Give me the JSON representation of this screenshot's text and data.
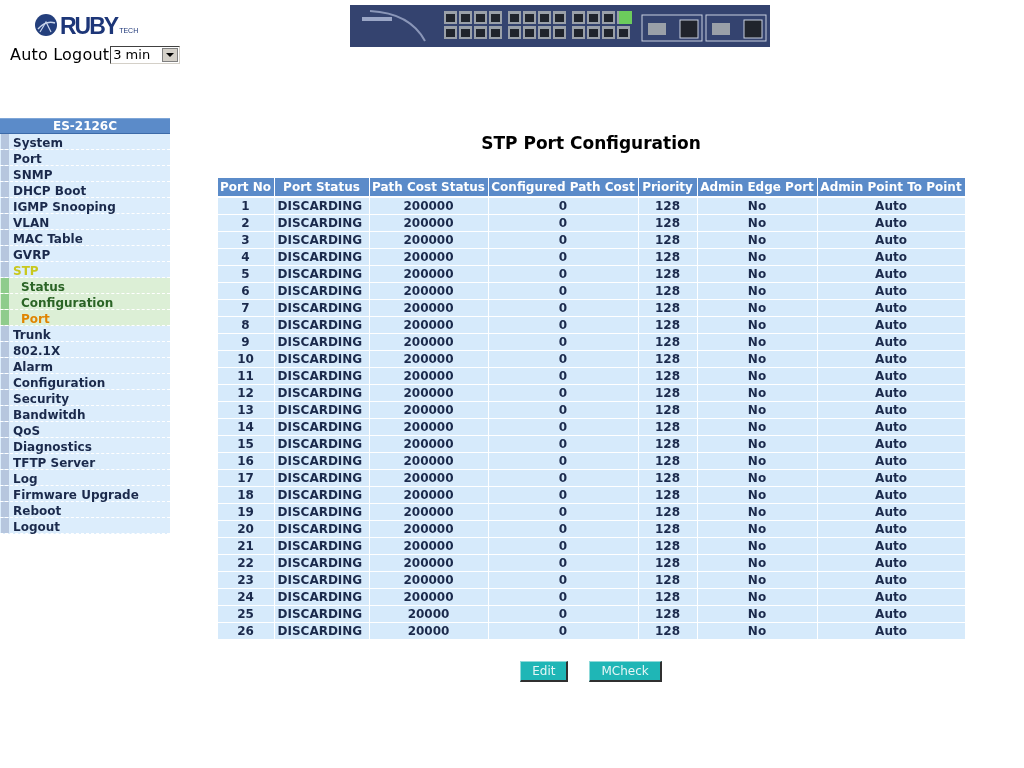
{
  "logo": {
    "name": "RUBY",
    "suffix": "TECH"
  },
  "auto_logout": {
    "label": "Auto Logout",
    "value": "3 min"
  },
  "sidebar": {
    "title": "ES-2126C",
    "items": [
      {
        "label": "System",
        "selected": false,
        "expanded": false
      },
      {
        "label": "Port",
        "selected": false,
        "expanded": false
      },
      {
        "label": "SNMP",
        "selected": false,
        "expanded": false
      },
      {
        "label": "DHCP Boot",
        "selected": false,
        "expanded": false
      },
      {
        "label": "IGMP Snooping",
        "selected": false,
        "expanded": false
      },
      {
        "label": "VLAN",
        "selected": false,
        "expanded": false
      },
      {
        "label": "MAC Table",
        "selected": false,
        "expanded": false
      },
      {
        "label": "GVRP",
        "selected": false,
        "expanded": false
      },
      {
        "label": "STP",
        "selected": false,
        "expanded": true,
        "children": [
          {
            "label": "Status",
            "selected": false
          },
          {
            "label": "Configuration",
            "selected": false
          },
          {
            "label": "Port",
            "selected": true
          }
        ]
      },
      {
        "label": "Trunk",
        "selected": false,
        "expanded": false
      },
      {
        "label": "802.1X",
        "selected": false,
        "expanded": false
      },
      {
        "label": "Alarm",
        "selected": false,
        "expanded": false
      },
      {
        "label": "Configuration",
        "selected": false,
        "expanded": false
      },
      {
        "label": "Security",
        "selected": false,
        "expanded": false
      },
      {
        "label": "Bandwitdh",
        "selected": false,
        "expanded": false
      },
      {
        "label": "QoS",
        "selected": false,
        "expanded": false
      },
      {
        "label": "Diagnostics",
        "selected": false,
        "expanded": false
      },
      {
        "label": "TFTP Server",
        "selected": false,
        "expanded": false
      },
      {
        "label": "Log",
        "selected": false,
        "expanded": false
      },
      {
        "label": "Firmware Upgrade",
        "selected": false,
        "expanded": false
      },
      {
        "label": "Reboot",
        "selected": false,
        "expanded": false
      },
      {
        "label": "Logout",
        "selected": false,
        "expanded": false
      }
    ]
  },
  "content": {
    "title": "STP Port Configuration",
    "table": {
      "columns": [
        "Port No",
        "Port Status",
        "Path Cost Status",
        "Configured Path Cost",
        "Priority",
        "Admin Edge Port",
        "Admin Point To Point"
      ],
      "rows": [
        [
          "1",
          "DISCARDING",
          "200000",
          "0",
          "128",
          "No",
          "Auto"
        ],
        [
          "2",
          "DISCARDING",
          "200000",
          "0",
          "128",
          "No",
          "Auto"
        ],
        [
          "3",
          "DISCARDING",
          "200000",
          "0",
          "128",
          "No",
          "Auto"
        ],
        [
          "4",
          "DISCARDING",
          "200000",
          "0",
          "128",
          "No",
          "Auto"
        ],
        [
          "5",
          "DISCARDING",
          "200000",
          "0",
          "128",
          "No",
          "Auto"
        ],
        [
          "6",
          "DISCARDING",
          "200000",
          "0",
          "128",
          "No",
          "Auto"
        ],
        [
          "7",
          "DISCARDING",
          "200000",
          "0",
          "128",
          "No",
          "Auto"
        ],
        [
          "8",
          "DISCARDING",
          "200000",
          "0",
          "128",
          "No",
          "Auto"
        ],
        [
          "9",
          "DISCARDING",
          "200000",
          "0",
          "128",
          "No",
          "Auto"
        ],
        [
          "10",
          "DISCARDING",
          "200000",
          "0",
          "128",
          "No",
          "Auto"
        ],
        [
          "11",
          "DISCARDING",
          "200000",
          "0",
          "128",
          "No",
          "Auto"
        ],
        [
          "12",
          "DISCARDING",
          "200000",
          "0",
          "128",
          "No",
          "Auto"
        ],
        [
          "13",
          "DISCARDING",
          "200000",
          "0",
          "128",
          "No",
          "Auto"
        ],
        [
          "14",
          "DISCARDING",
          "200000",
          "0",
          "128",
          "No",
          "Auto"
        ],
        [
          "15",
          "DISCARDING",
          "200000",
          "0",
          "128",
          "No",
          "Auto"
        ],
        [
          "16",
          "DISCARDING",
          "200000",
          "0",
          "128",
          "No",
          "Auto"
        ],
        [
          "17",
          "DISCARDING",
          "200000",
          "0",
          "128",
          "No",
          "Auto"
        ],
        [
          "18",
          "DISCARDING",
          "200000",
          "0",
          "128",
          "No",
          "Auto"
        ],
        [
          "19",
          "DISCARDING",
          "200000",
          "0",
          "128",
          "No",
          "Auto"
        ],
        [
          "20",
          "DISCARDING",
          "200000",
          "0",
          "128",
          "No",
          "Auto"
        ],
        [
          "21",
          "DISCARDING",
          "200000",
          "0",
          "128",
          "No",
          "Auto"
        ],
        [
          "22",
          "DISCARDING",
          "200000",
          "0",
          "128",
          "No",
          "Auto"
        ],
        [
          "23",
          "DISCARDING",
          "200000",
          "0",
          "128",
          "No",
          "Auto"
        ],
        [
          "24",
          "DISCARDING",
          "200000",
          "0",
          "128",
          "No",
          "Auto"
        ],
        [
          "25",
          "DISCARDING",
          "20000",
          "0",
          "128",
          "No",
          "Auto"
        ],
        [
          "26",
          "DISCARDING",
          "20000",
          "0",
          "128",
          "No",
          "Auto"
        ]
      ]
    },
    "buttons": [
      {
        "label": "Edit"
      },
      {
        "label": "MCheck"
      }
    ]
  }
}
